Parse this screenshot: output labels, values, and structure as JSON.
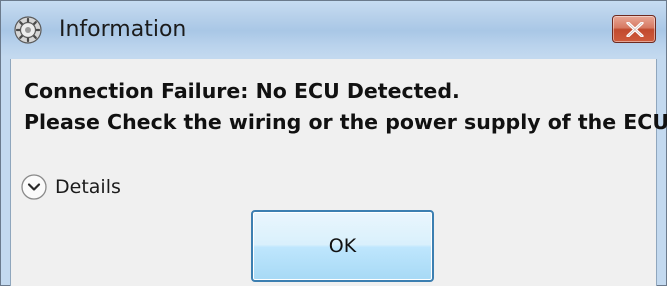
{
  "window": {
    "title": "Information",
    "icon": "gear-icon",
    "close_icon": "close-icon"
  },
  "message": {
    "line1": "Connection Failure: No ECU Detected.",
    "line2": "Please Check the wiring or the power supply of the ECU."
  },
  "details": {
    "label": "Details",
    "icon": "chevron-down-icon",
    "expanded": false
  },
  "buttons": {
    "ok_label": "OK"
  },
  "colors": {
    "title_bar": "#b7d0ea",
    "close_button": "#c14a2e",
    "client_area": "#f0f0f0",
    "ok_button_border": "#3c7fb1"
  }
}
